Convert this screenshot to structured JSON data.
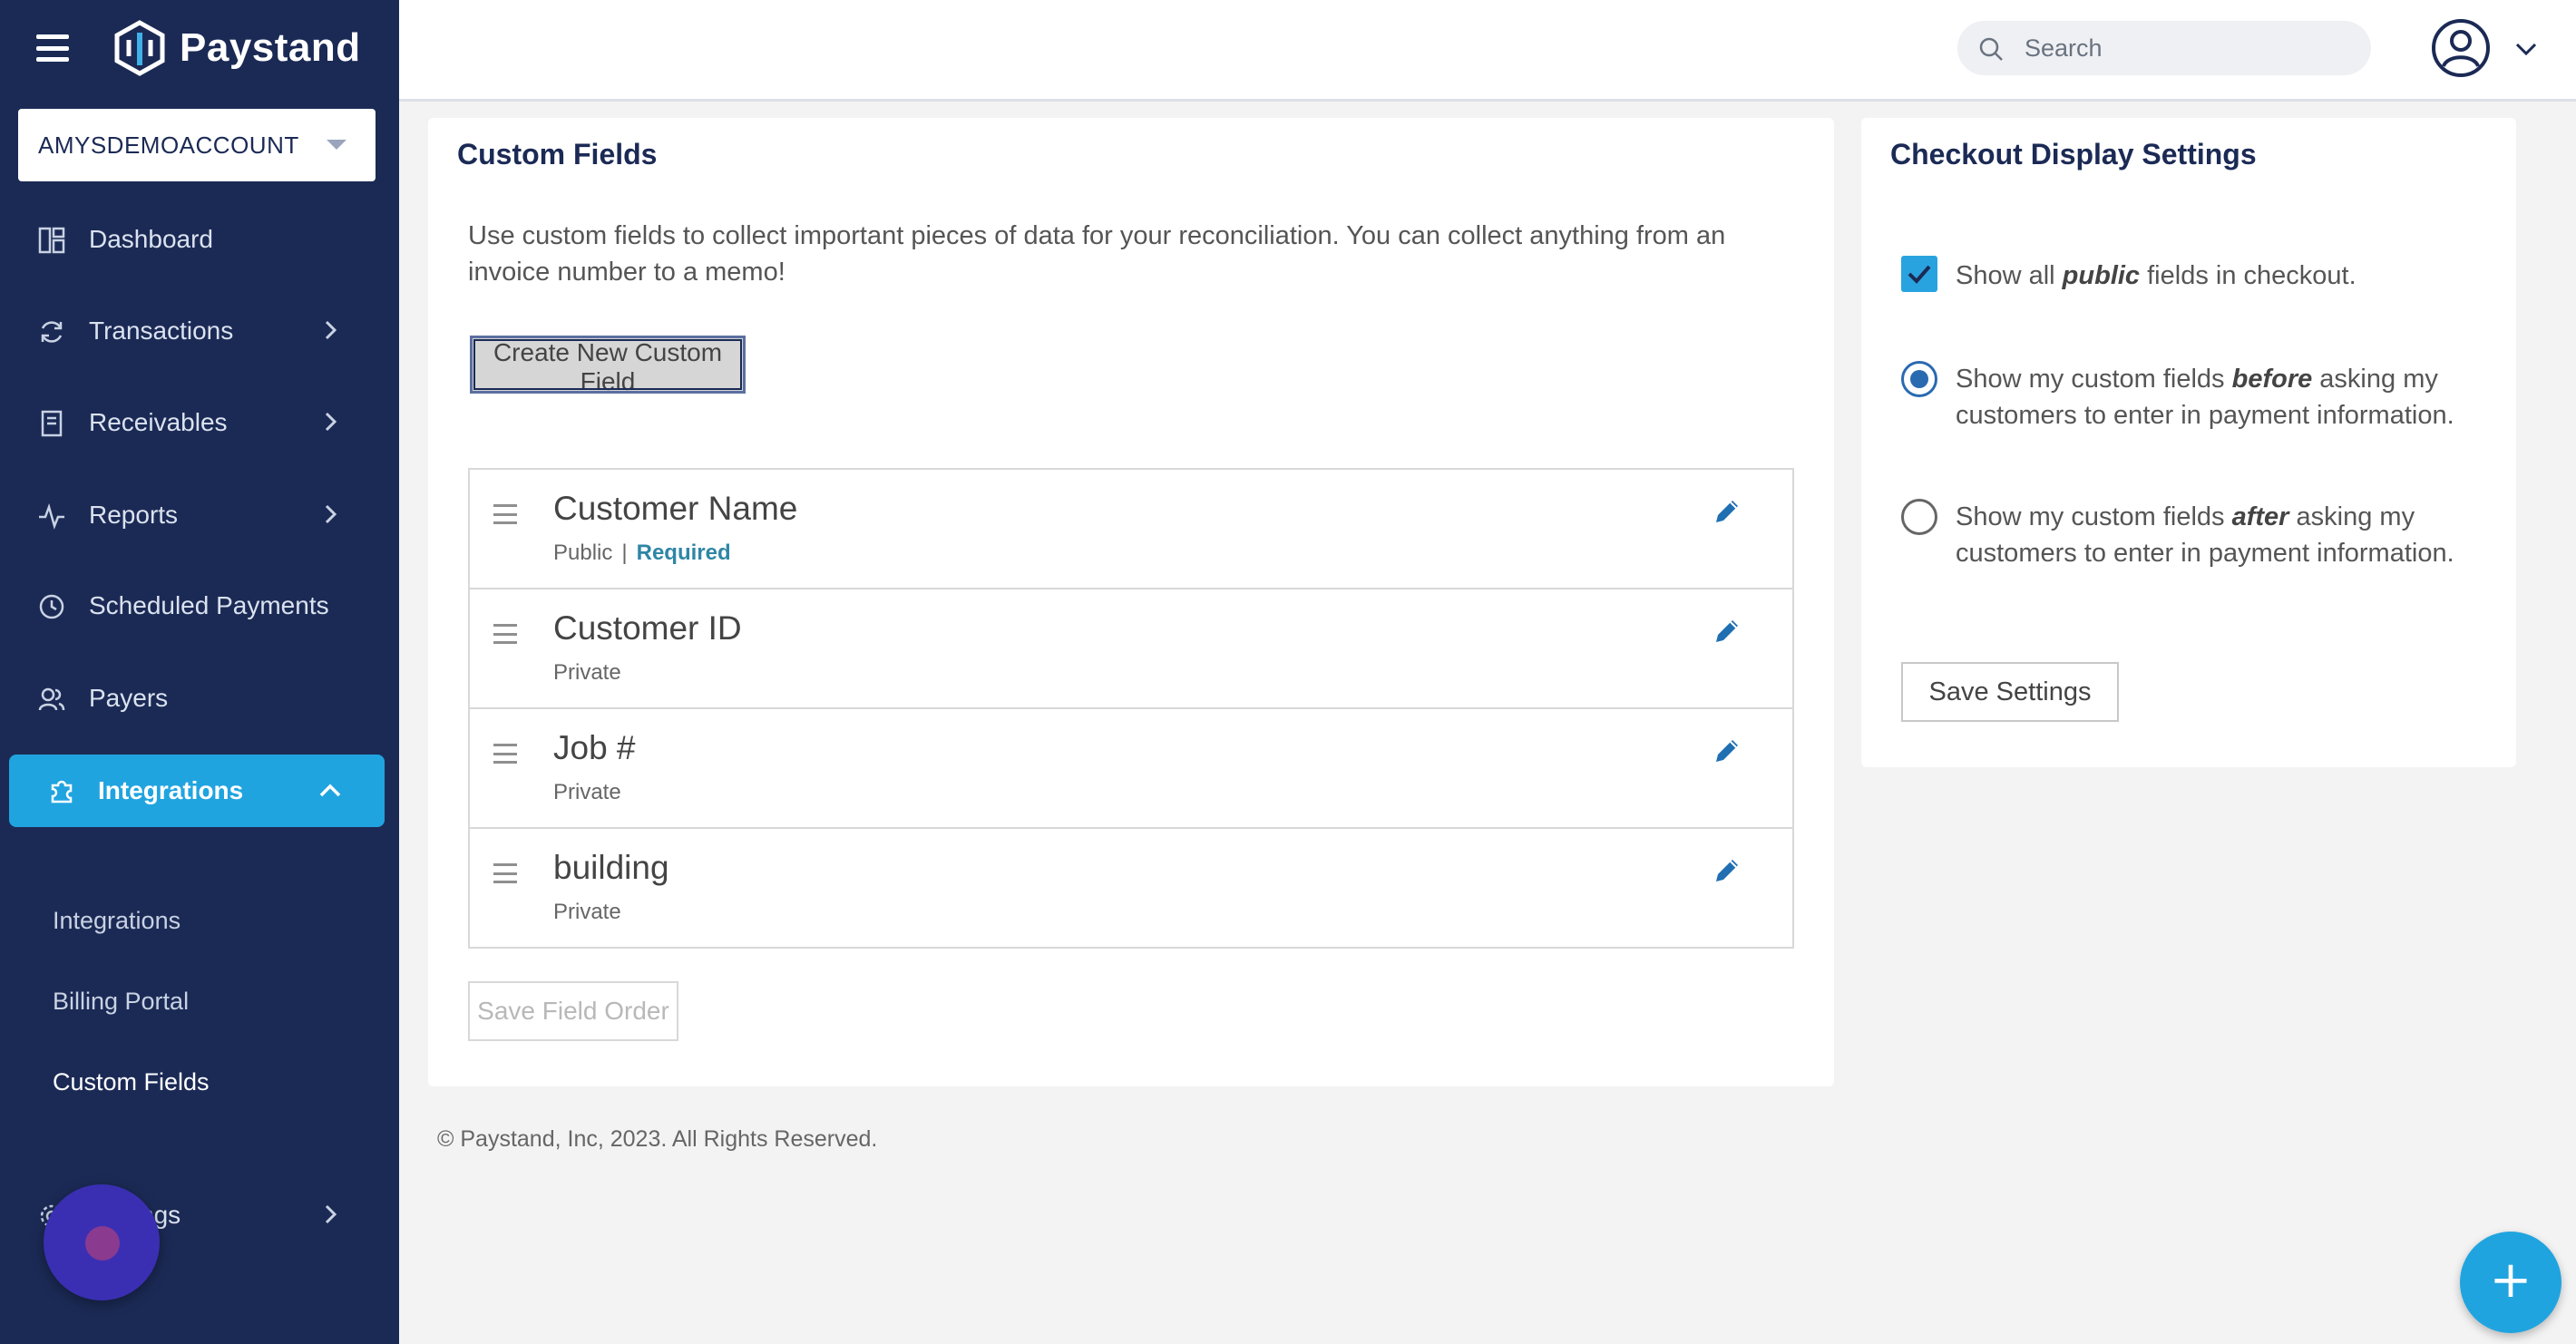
{
  "brand": {
    "name": "Paystand"
  },
  "account": {
    "name": "AMYSDEMOACCOUNT"
  },
  "nav": {
    "items": [
      {
        "label": "Dashboard",
        "icon": "dashboard-icon"
      },
      {
        "label": "Transactions",
        "icon": "refresh-icon"
      },
      {
        "label": "Receivables",
        "icon": "receipt-icon"
      },
      {
        "label": "Reports",
        "icon": "pulse-icon"
      },
      {
        "label": "Scheduled Payments",
        "icon": "clock-icon"
      },
      {
        "label": "Payers",
        "icon": "users-icon"
      }
    ],
    "active": {
      "label": "Integrations",
      "icon": "puzzle-icon"
    },
    "sub_items": [
      {
        "label": "Integrations"
      },
      {
        "label": "Billing Portal"
      },
      {
        "label": "Custom Fields"
      }
    ],
    "settings": {
      "label": "Settings"
    }
  },
  "search": {
    "placeholder": "Search"
  },
  "custom_fields": {
    "title": "Custom Fields",
    "description": "Use custom fields to collect important pieces of data for your reconciliation. You can collect anything from an invoice number to a memo!",
    "create_label": "Create New Custom Field",
    "fields": [
      {
        "name": "Customer Name",
        "visibility": "Public",
        "separator": "|",
        "required": "Required"
      },
      {
        "name": "Customer ID",
        "visibility": "Private"
      },
      {
        "name": "Job #",
        "visibility": "Private"
      },
      {
        "name": "building",
        "visibility": "Private"
      }
    ],
    "save_order_label": "Save Field Order"
  },
  "checkout": {
    "title": "Checkout Display Settings",
    "show_public": {
      "pre": "Show all ",
      "em": "public",
      "post": " fields in checkout.",
      "checked": true
    },
    "before": {
      "pre": "Show my custom fields ",
      "em": "before",
      "post": " asking my customers to enter in payment information.",
      "selected": true
    },
    "after": {
      "pre": "Show my custom fields ",
      "em": "after",
      "post": " asking my customers to enter in payment information.",
      "selected": false
    },
    "save_label": "Save Settings"
  },
  "footer": {
    "text": "© Paystand, Inc, 2023. All Rights Reserved."
  },
  "fab": {
    "label": "+"
  },
  "colors": {
    "sidebar": "#1b2a55",
    "accent": "#20a4e0",
    "required": "#2f86a6",
    "edit": "#1f6fb2"
  }
}
